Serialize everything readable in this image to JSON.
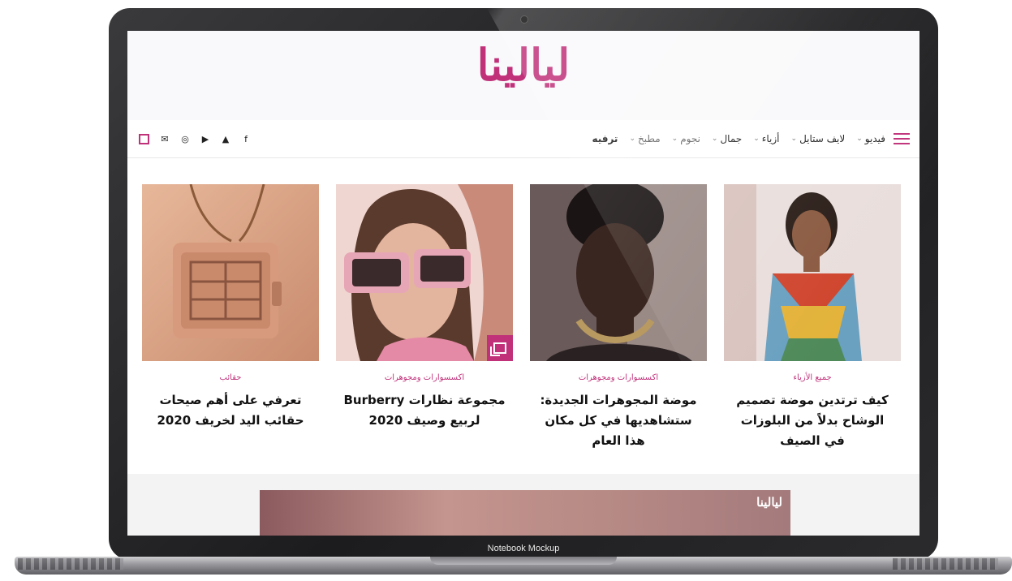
{
  "mockup": {
    "label": "Notebook Mockup"
  },
  "site": {
    "logo": "ليالينا",
    "nav": [
      {
        "label": "فيديو",
        "has_dropdown": true
      },
      {
        "label": "لايف ستايل",
        "has_dropdown": true
      },
      {
        "label": "أزياء",
        "has_dropdown": true
      },
      {
        "label": "جمال",
        "has_dropdown": true
      },
      {
        "label": "نجوم",
        "has_dropdown": true
      },
      {
        "label": "مطبخ",
        "has_dropdown": true
      },
      {
        "label": "ترفيه",
        "has_dropdown": false
      }
    ],
    "social_icons": [
      "facebook-icon",
      "snapchat-icon",
      "youtube-icon",
      "instagram-icon",
      "mail-icon",
      "search-icon"
    ],
    "articles": [
      {
        "category": "حقائب",
        "title": "تعرفي على أهم صيحات حقائب اليد لخريف 2020",
        "image": "handbag",
        "gallery": false
      },
      {
        "category": "اكسسوارات ومجوهرات",
        "title": "مجموعة نظارات Burberry لربيع وصيف 2020",
        "image": "sunglasses",
        "gallery": true
      },
      {
        "category": "اكسسوارات ومجوهرات",
        "title": "موضة المجوهرات الجديدة: ستشاهديها في كل مكان هذا العام",
        "image": "jewelry",
        "gallery": false
      },
      {
        "category": "جميع الأزياء",
        "title": "كيف ترتدين موضة تصميم الوشاح بدلاً من البلوزات في الصيف",
        "image": "scarf",
        "gallery": false
      }
    ],
    "banner_logo": "ليالينا"
  },
  "colors": {
    "brand": "#c0317a",
    "text": "#111111"
  }
}
